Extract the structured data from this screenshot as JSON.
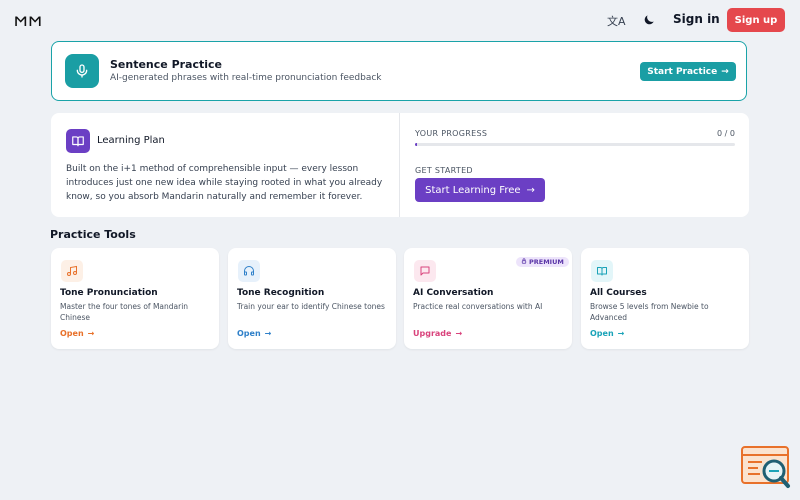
{
  "topbar": {
    "logo": "𐌼𐌼",
    "lang_label": "文A",
    "signin_label": "Sign in",
    "signup_label": "Sign up"
  },
  "sentence_practice": {
    "title": "Sentence Practice",
    "subtitle": "AI-generated phrases with real-time pronunciation feedback",
    "button_label": "Start Practice",
    "accent_color": "#1a9ea4"
  },
  "learning_plan": {
    "title": "Learning Plan",
    "description": "Built on the i+1 method of comprehensible input — every lesson introduces just one new idea while staying rooted in what you already know, so you absorb Mandarin naturally and remember it forever.",
    "progress_label": "YOUR PROGRESS",
    "progress_count": "0 / 0",
    "progress_fraction": 0,
    "get_started_label": "GET STARTED",
    "start_button_label": "Start Learning Free",
    "accent_color": "#6b3fc4"
  },
  "practice_tools": {
    "heading": "Practice Tools",
    "premium_badge": "PREMIUM",
    "tools": [
      {
        "icon": "music-note-icon",
        "title": "Tone Pronunciation",
        "description": "Master the four tones of Mandarin Chinese",
        "link": "Open",
        "color": "#e8712a"
      },
      {
        "icon": "headphones-icon",
        "title": "Tone Recognition",
        "description": "Train your ear to identify Chinese tones",
        "link": "Open",
        "color": "#2f80c9"
      },
      {
        "icon": "chat-bubble-icon",
        "title": "AI Conversation",
        "description": "Practice real conversations with AI",
        "link": "Upgrade",
        "color": "#d9437c"
      },
      {
        "icon": "open-book-icon",
        "title": "All Courses",
        "description": "Browse 5 levels from Newbie to Advanced",
        "link": "Open",
        "color": "#1aa3b8"
      }
    ]
  }
}
